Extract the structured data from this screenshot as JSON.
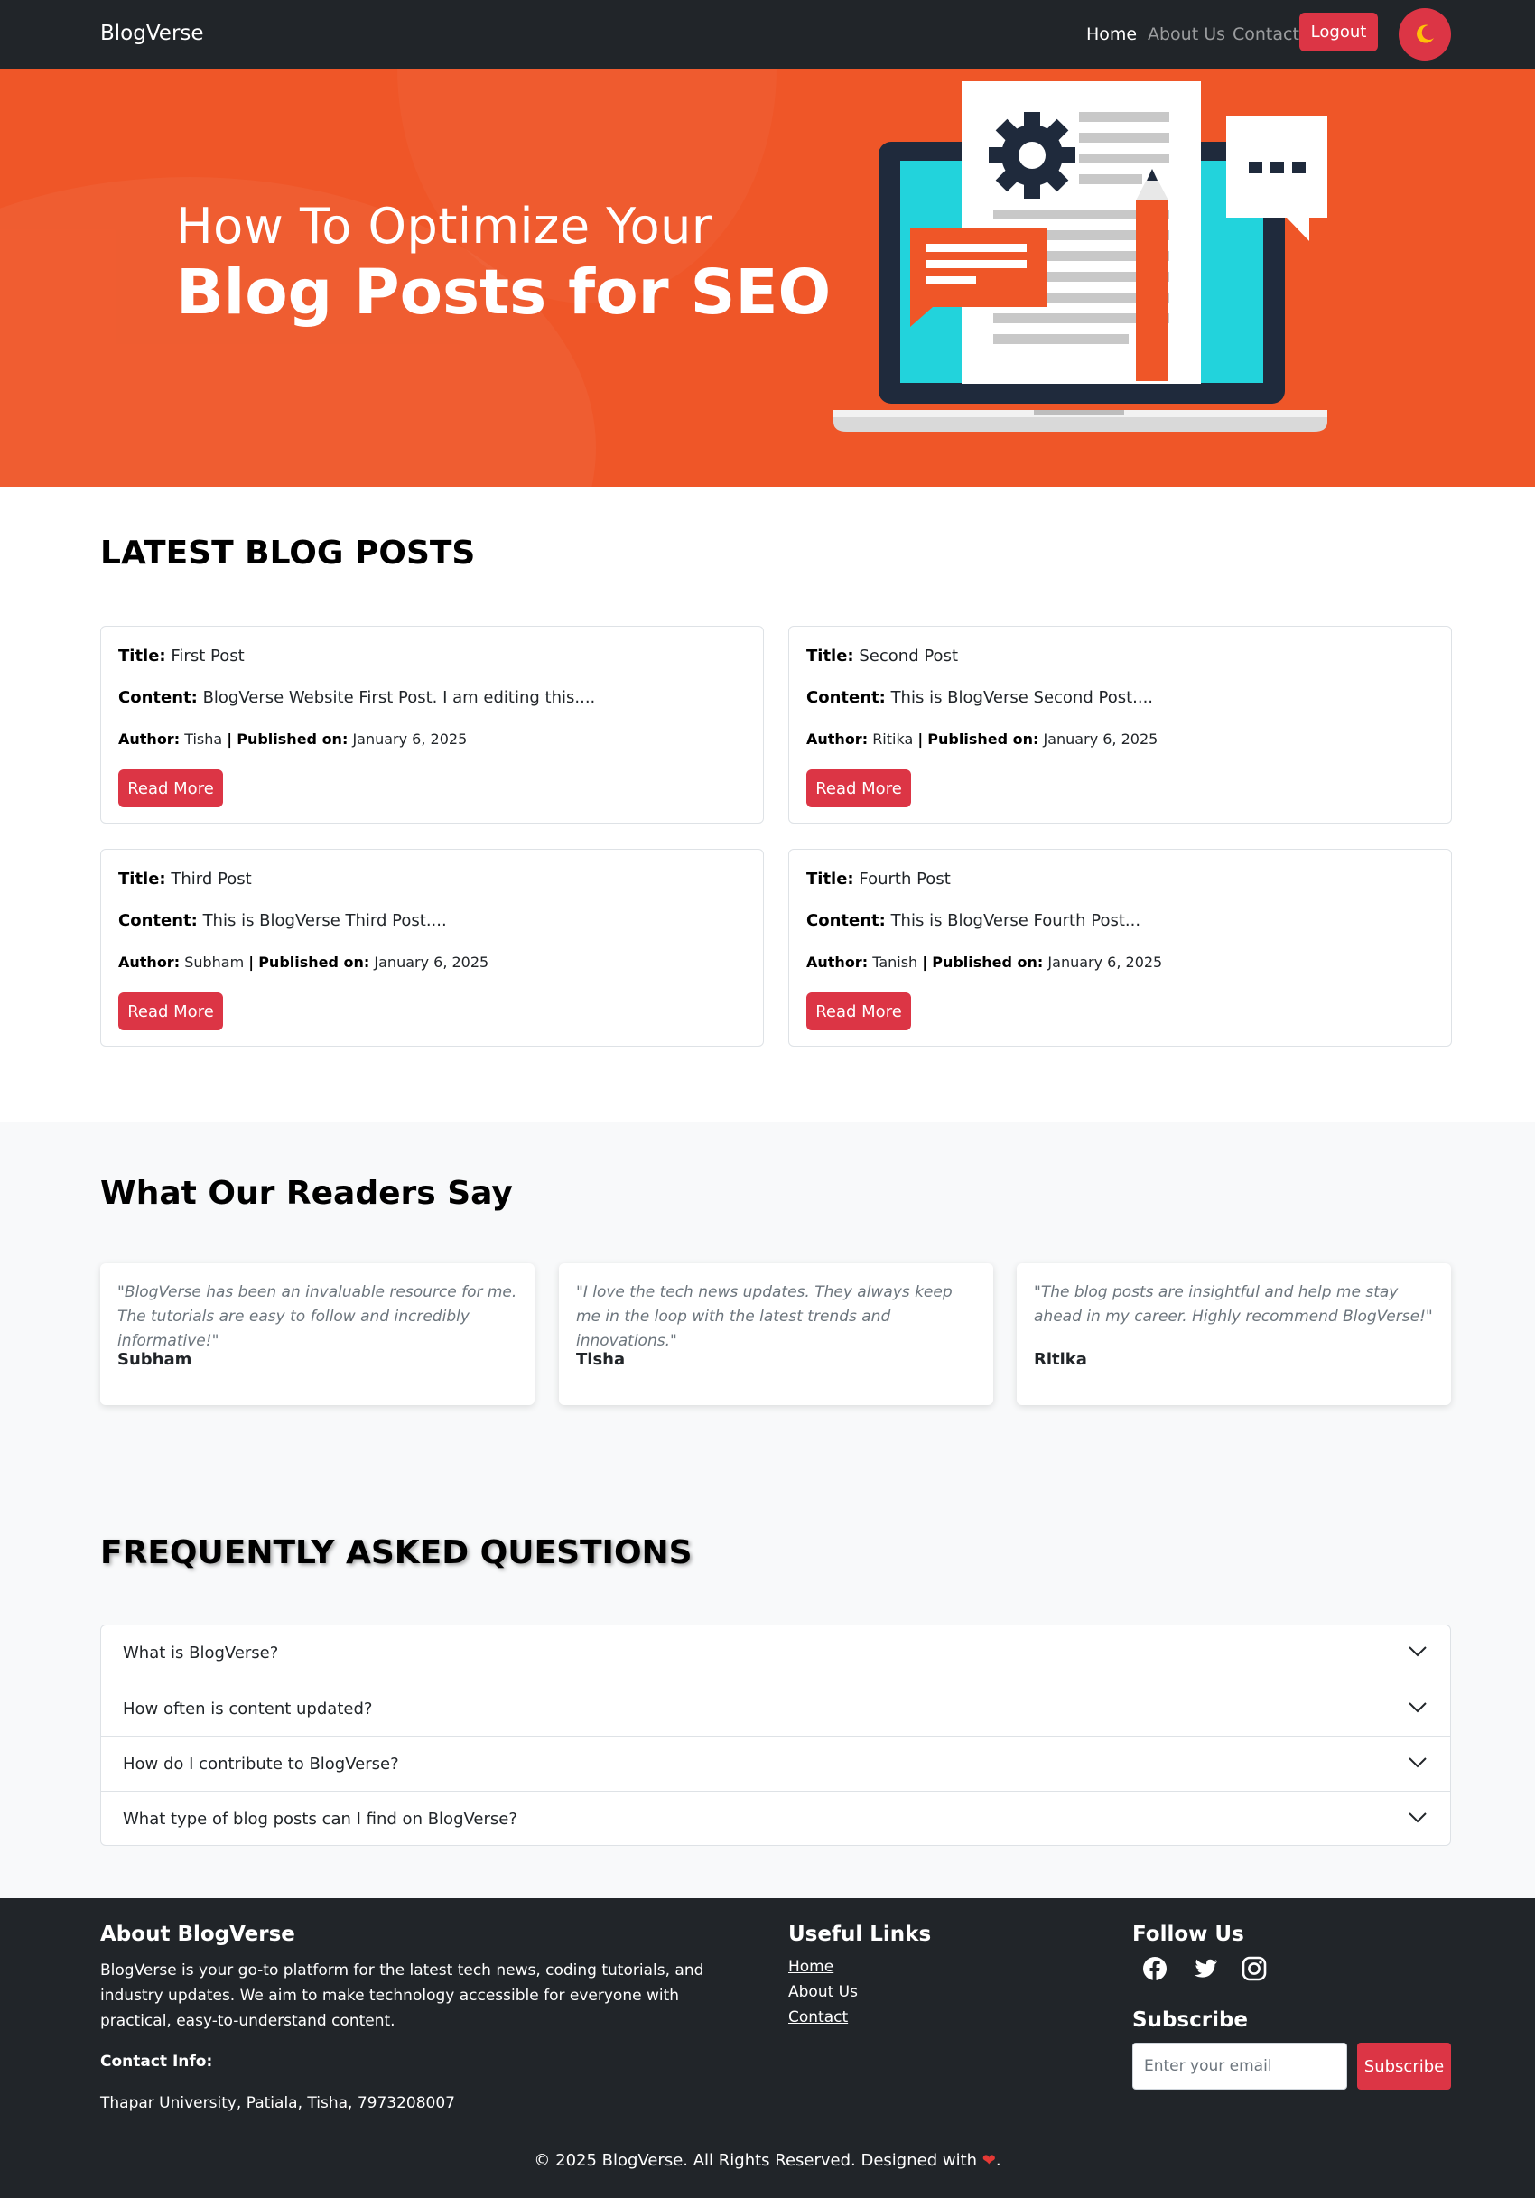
{
  "navbar": {
    "brand": "BlogVerse",
    "links": [
      {
        "label": "Home",
        "active": true
      },
      {
        "label": "About Us",
        "active": false
      },
      {
        "label": "Contact",
        "active": false
      }
    ],
    "logout_label": "Logout",
    "theme_toggle_icon": "moon-icon"
  },
  "hero": {
    "line1": "How To Optimize Your",
    "line2": "Blog Posts for SEO",
    "background_color": "#ef5628"
  },
  "posts": {
    "heading": "LATEST BLOG POSTS",
    "title_label": "Title:",
    "content_label": "Content:",
    "author_label": "Author:",
    "published_label": "Published on:",
    "separator": "|",
    "read_more_label": "Read More",
    "items": [
      {
        "title": "First Post",
        "content": "BlogVerse Website First Post. I am editing this....",
        "author": "Tisha",
        "date": "January 6, 2025"
      },
      {
        "title": "Second Post",
        "content": "This is BlogVerse Second Post....",
        "author": "Ritika",
        "date": "January 6, 2025"
      },
      {
        "title": "Third Post",
        "content": "This is BlogVerse Third Post....",
        "author": "Subham",
        "date": "January 6, 2025"
      },
      {
        "title": "Fourth Post",
        "content": "This is BlogVerse Fourth Post...",
        "author": "Tanish",
        "date": "January 6, 2025"
      }
    ]
  },
  "testimonials": {
    "heading": "What Our Readers Say",
    "items": [
      {
        "quote": "\"BlogVerse has been an invaluable resource for me. The tutorials are easy to follow and incredibly informative!\"",
        "name": "Subham"
      },
      {
        "quote": "\"I love the tech news updates. They always keep me in the loop with the latest trends and innovations.\"",
        "name": "Tisha"
      },
      {
        "quote": "\"The blog posts are insightful and help me stay ahead in my career. Highly recommend BlogVerse!\"",
        "name": "Ritika"
      }
    ]
  },
  "faq": {
    "heading": "FREQUENTLY ASKED QUESTIONS",
    "items": [
      {
        "question": "What is BlogVerse?"
      },
      {
        "question": "How often is content updated?"
      },
      {
        "question": "How do I contribute to BlogVerse?"
      },
      {
        "question": "What type of blog posts can I find on BlogVerse?"
      }
    ]
  },
  "footer": {
    "about_heading": "About BlogVerse",
    "about_text": "BlogVerse is your go-to platform for the latest tech news, coding tutorials, and industry updates. We aim to make technology accessible for everyone with practical, easy-to-understand content.",
    "contact_label": "Contact Info:",
    "contact_value": "Thapar University, Patiala, Tisha, 7973208007",
    "links_heading": "Useful Links",
    "links": [
      {
        "label": "Home"
      },
      {
        "label": "About Us"
      },
      {
        "label": "Contact"
      }
    ],
    "follow_heading": "Follow Us",
    "social_icons": [
      "facebook-icon",
      "twitter-icon",
      "instagram-icon"
    ],
    "subscribe_heading": "Subscribe",
    "email_placeholder": "Enter your email",
    "subscribe_label": "Subscribe",
    "copyright": "© 2025 BlogVerse. All Rights Reserved. Designed with",
    "copyright_end": "."
  },
  "colors": {
    "navbar_bg": "#212529",
    "accent_red": "#dc3545",
    "hero_orange": "#ef5628",
    "section_bg": "#f8f9fa"
  }
}
